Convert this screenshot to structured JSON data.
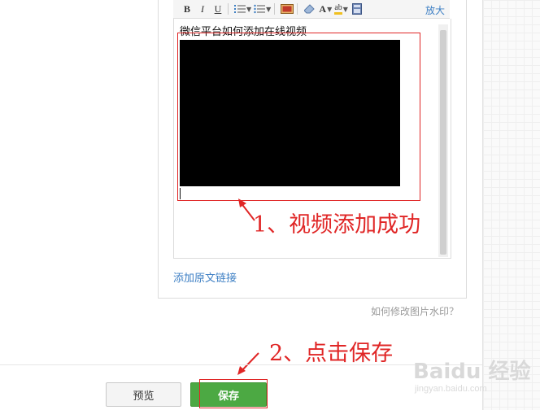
{
  "toolbar": {
    "bold": "B",
    "italic": "I",
    "underline": "U",
    "ordered_list_icon": "ordered-list-icon",
    "bullet_list_icon": "bullet-list-icon",
    "image_icon": "image-icon",
    "eraser_icon": "eraser-icon",
    "font_color_icon": "font-color-icon",
    "font_color_glyph": "A",
    "highlight_icon": "highlight-icon",
    "highlight_glyph": "ab",
    "save_doc_icon": "document-icon",
    "expand_label": "放大"
  },
  "editor": {
    "content_title": "微信平台如何添加在线视频"
  },
  "annotations": {
    "step1": "1、视频添加成功",
    "step2": "2、点击保存",
    "color": "#e02626"
  },
  "links": {
    "source_link": "添加原文链接",
    "watermark_help": "如何修改图片水印？"
  },
  "buttons": {
    "preview": "预览",
    "save": "保存"
  },
  "watermark": {
    "brand": "Baidu 经验",
    "sub": "jingyan.baidu.com"
  },
  "colors": {
    "accent_green": "#4ca943",
    "link_blue": "#3d7fc4"
  }
}
